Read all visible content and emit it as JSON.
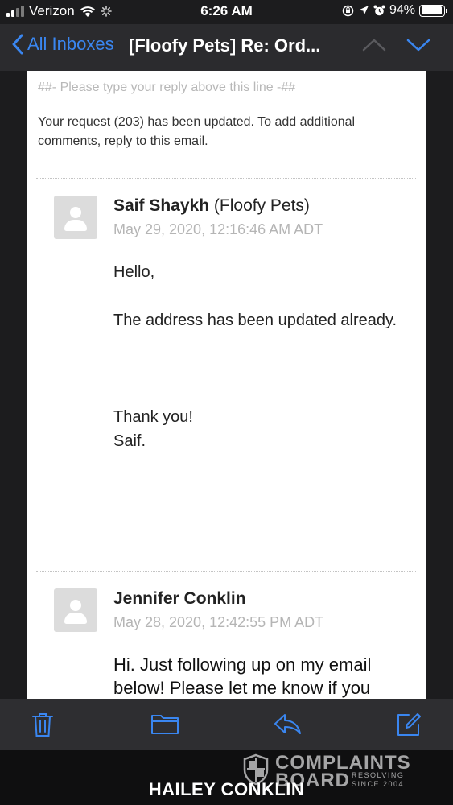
{
  "status_bar": {
    "carrier": "Verizon",
    "time": "6:26 AM",
    "battery": "94%",
    "battery_level": 0.94
  },
  "nav": {
    "back_label": "All Inboxes",
    "title": "[Floofy Pets] Re: Ord..."
  },
  "email": {
    "reply_line": "##- Please type your reply above this line -##",
    "intro": "Your request (203) has been updated. To add additional comments, reply to this email.",
    "messages": [
      {
        "sender_name": "Saif Shaykh",
        "sender_org": " (Floofy Pets)",
        "date": "May 29, 2020, 12:16:46 AM ADT",
        "greeting": "Hello,",
        "body": "The address has been updated already.",
        "closing": "Thank you!",
        "signature": "Saif."
      },
      {
        "sender_name": "Jennifer Conklin",
        "date": "May 28, 2020, 12:42:55 PM ADT",
        "body": "Hi. Just following up on my email below! Please let me know if you"
      }
    ]
  },
  "toolbar": {
    "icons": [
      "trash-icon",
      "folder-icon",
      "reply-icon",
      "compose-icon"
    ]
  },
  "watermark": {
    "line1": "COMPLAINTS",
    "line2": "BOARD",
    "tag1": "RESOLVING",
    "tag2": "SINCE 2004"
  },
  "footer": {
    "name": "HAILEY CONKLIN"
  },
  "colors": {
    "accent": "#3a86f0",
    "nav_bg": "#2b2b2e",
    "sheet_bg": "#ffffff"
  }
}
